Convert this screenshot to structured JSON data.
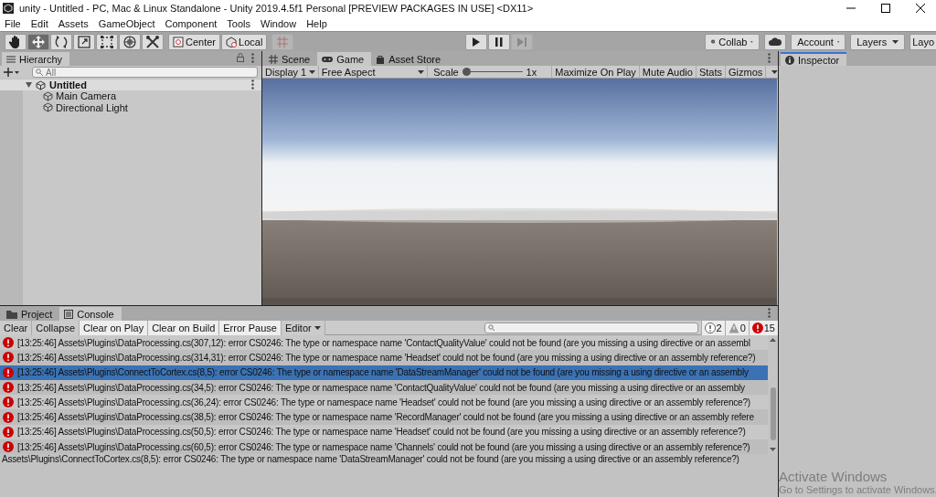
{
  "window": {
    "title": "unity - Untitled - PC, Mac & Linux Standalone - Unity 2019.4.5f1 Personal [PREVIEW PACKAGES IN USE] <DX11>"
  },
  "menu": [
    "File",
    "Edit",
    "Assets",
    "GameObject",
    "Component",
    "Tools",
    "Window",
    "Help"
  ],
  "toolbar": {
    "tools": [
      {
        "kind": "hand",
        "selected": false
      },
      {
        "kind": "move",
        "selected": true
      },
      {
        "kind": "rotate",
        "selected": false
      },
      {
        "kind": "scale",
        "selected": false
      },
      {
        "kind": "rect",
        "selected": false
      },
      {
        "kind": "transform",
        "selected": false
      },
      {
        "kind": "custom",
        "selected": false
      }
    ],
    "pivot": [
      {
        "kind": "center",
        "label": "Center"
      },
      {
        "kind": "local",
        "label": "Local"
      }
    ],
    "play": [
      {
        "kind": "play",
        "disabled": false
      },
      {
        "kind": "pause",
        "disabled": false
      },
      {
        "kind": "step",
        "disabled": true
      }
    ],
    "collab": "Collab",
    "account": "Account",
    "layers": "Layers",
    "layout": "Layo"
  },
  "hierarchy": {
    "tab": "Hierarchy",
    "search_placeholder": "All",
    "scene": {
      "name": "Untitled",
      "expanded": true,
      "children": [
        {
          "name": "Main Camera"
        },
        {
          "name": "Directional Light"
        }
      ]
    }
  },
  "game": {
    "tabs": [
      {
        "kind": "scene",
        "label": "Scene",
        "selected": false
      },
      {
        "kind": "game",
        "label": "Game",
        "selected": true
      },
      {
        "kind": "store",
        "label": "Asset Store",
        "selected": false
      }
    ],
    "display": "Display 1",
    "aspect": "Free Aspect",
    "scale_label": "Scale",
    "scale": {
      "level": 0.0
    },
    "scale_reading": "1x",
    "buttons": [
      "Maximize On Play",
      "Mute Audio",
      "Stats",
      "Gizmos"
    ]
  },
  "inspector": {
    "tab": "Inspector"
  },
  "console": {
    "tabs": [
      {
        "kind": "project",
        "label": "Project",
        "selected": false
      },
      {
        "kind": "console",
        "label": "Console",
        "selected": true
      }
    ],
    "buttons": [
      {
        "label": "Clear",
        "on": false
      },
      {
        "label": "Collapse",
        "on": false
      },
      {
        "label": "Clear on Play",
        "on": true
      },
      {
        "label": "Clear on Build",
        "on": true
      },
      {
        "label": "Error Pause",
        "on": true
      }
    ],
    "editor": "Editor",
    "counts": [
      {
        "kind": "info",
        "count": "2"
      },
      {
        "kind": "warning",
        "count": "0"
      },
      {
        "kind": "error",
        "count": "15"
      }
    ],
    "rows": [
      {
        "text": "[13:25:46] Assets\\Plugins\\DataProcessing.cs(307,12): error CS0246: The type or namespace name 'ContactQualityValue' could not be found (are you missing a using directive or an assembl",
        "selected": false
      },
      {
        "text": "[13:25:46] Assets\\Plugins\\DataProcessing.cs(314,31): error CS0246: The type or namespace name 'Headset' could not be found (are you missing a using directive or an assembly reference?)",
        "selected": false
      },
      {
        "text": "[13:25:46] Assets\\Plugins\\ConnectToCortex.cs(8,5): error CS0246: The type or namespace name 'DataStreamManager' could not be found (are you missing a using directive or an assembly",
        "selected": true
      },
      {
        "text": "[13:25:46] Assets\\Plugins\\DataProcessing.cs(34,5): error CS0246: The type or namespace name 'ContactQualityValue' could not be found (are you missing a using directive or an assembly",
        "selected": false
      },
      {
        "text": "[13:25:46] Assets\\Plugins\\DataProcessing.cs(36,24): error CS0246: The type or namespace name 'Headset' could not be found (are you missing a using directive or an assembly reference?)",
        "selected": false
      },
      {
        "text": "[13:25:46] Assets\\Plugins\\DataProcessing.cs(38,5): error CS0246: The type or namespace name 'RecordManager' could not be found (are you missing a using directive or an assembly refere",
        "selected": false
      },
      {
        "text": "[13:25:46] Assets\\Plugins\\DataProcessing.cs(50,5): error CS0246: The type or namespace name 'Headset' could not be found (are you missing a using directive or an assembly reference?)",
        "selected": false
      },
      {
        "text": "[13:25:46] Assets\\Plugins\\DataProcessing.cs(60,5): error CS0246: The type or namespace name 'Channels' could not be found (are you missing a using directive or an assembly reference?)",
        "selected": false
      }
    ],
    "status_line": "Assets\\Plugins\\ConnectToCortex.cs(8,5): error CS0246: The type or namespace name 'DataStreamManager' could not be found (are you missing a using directive or an assembly reference?)"
  },
  "activation_notice": {
    "title": "Activate Windows",
    "text": "Go to Settings to activate Windows."
  }
}
